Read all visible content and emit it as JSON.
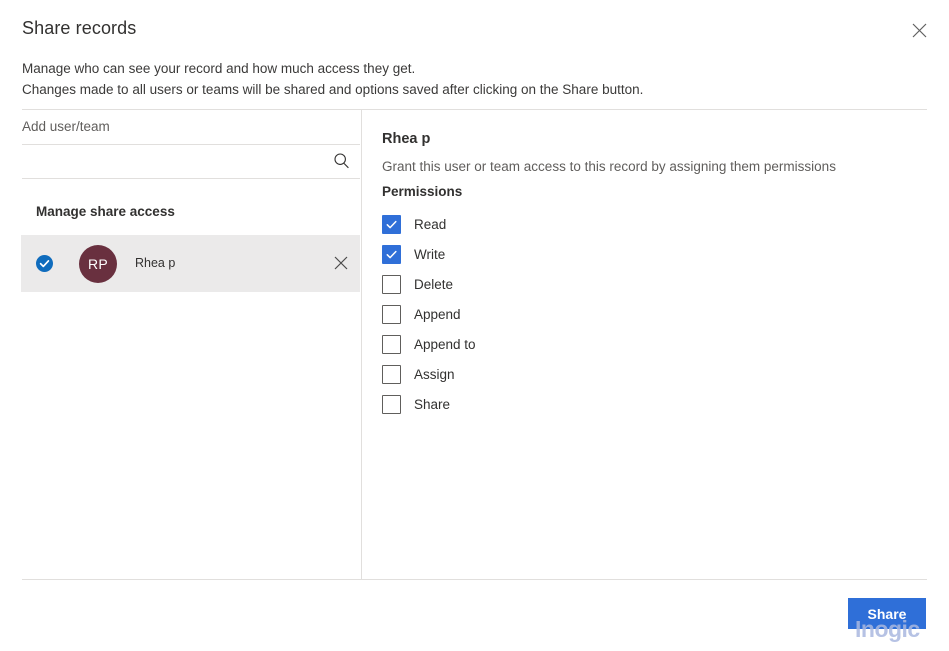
{
  "dialog": {
    "title": "Share records",
    "subtitle_line1": "Manage who can see your record and how much access they get.",
    "subtitle_line2": "Changes made to all users or teams will be shared and options saved after clicking on the Share button.",
    "close_icon": "close-icon"
  },
  "left_pane": {
    "add_label": "Add user/team",
    "search": {
      "value": "",
      "placeholder": "",
      "icon": "search-icon"
    },
    "section_label": "Manage share access",
    "rows": [
      {
        "initials": "RP",
        "name": "Rhea p",
        "selected": true,
        "avatar_color": "#69303f",
        "remove_icon": "close-icon"
      }
    ]
  },
  "right_pane": {
    "name": "Rhea p",
    "description": "Grant this user or team access to this record by assigning them permissions",
    "permissions_heading": "Permissions",
    "permissions": [
      {
        "label": "Read",
        "checked": true
      },
      {
        "label": "Write",
        "checked": true
      },
      {
        "label": "Delete",
        "checked": false
      },
      {
        "label": "Append",
        "checked": false
      },
      {
        "label": "Append to",
        "checked": false
      },
      {
        "label": "Assign",
        "checked": false
      },
      {
        "label": "Share",
        "checked": false
      }
    ]
  },
  "footer": {
    "share_label": "Share"
  },
  "watermark": {
    "text": "Inogic"
  },
  "colors": {
    "accent": "#2f6fd8",
    "avatar": "#69303f",
    "row_selected_bg": "#ebeaea",
    "divider": "#e1dfdd",
    "text_primary": "#323130",
    "text_secondary": "#605e5c"
  }
}
